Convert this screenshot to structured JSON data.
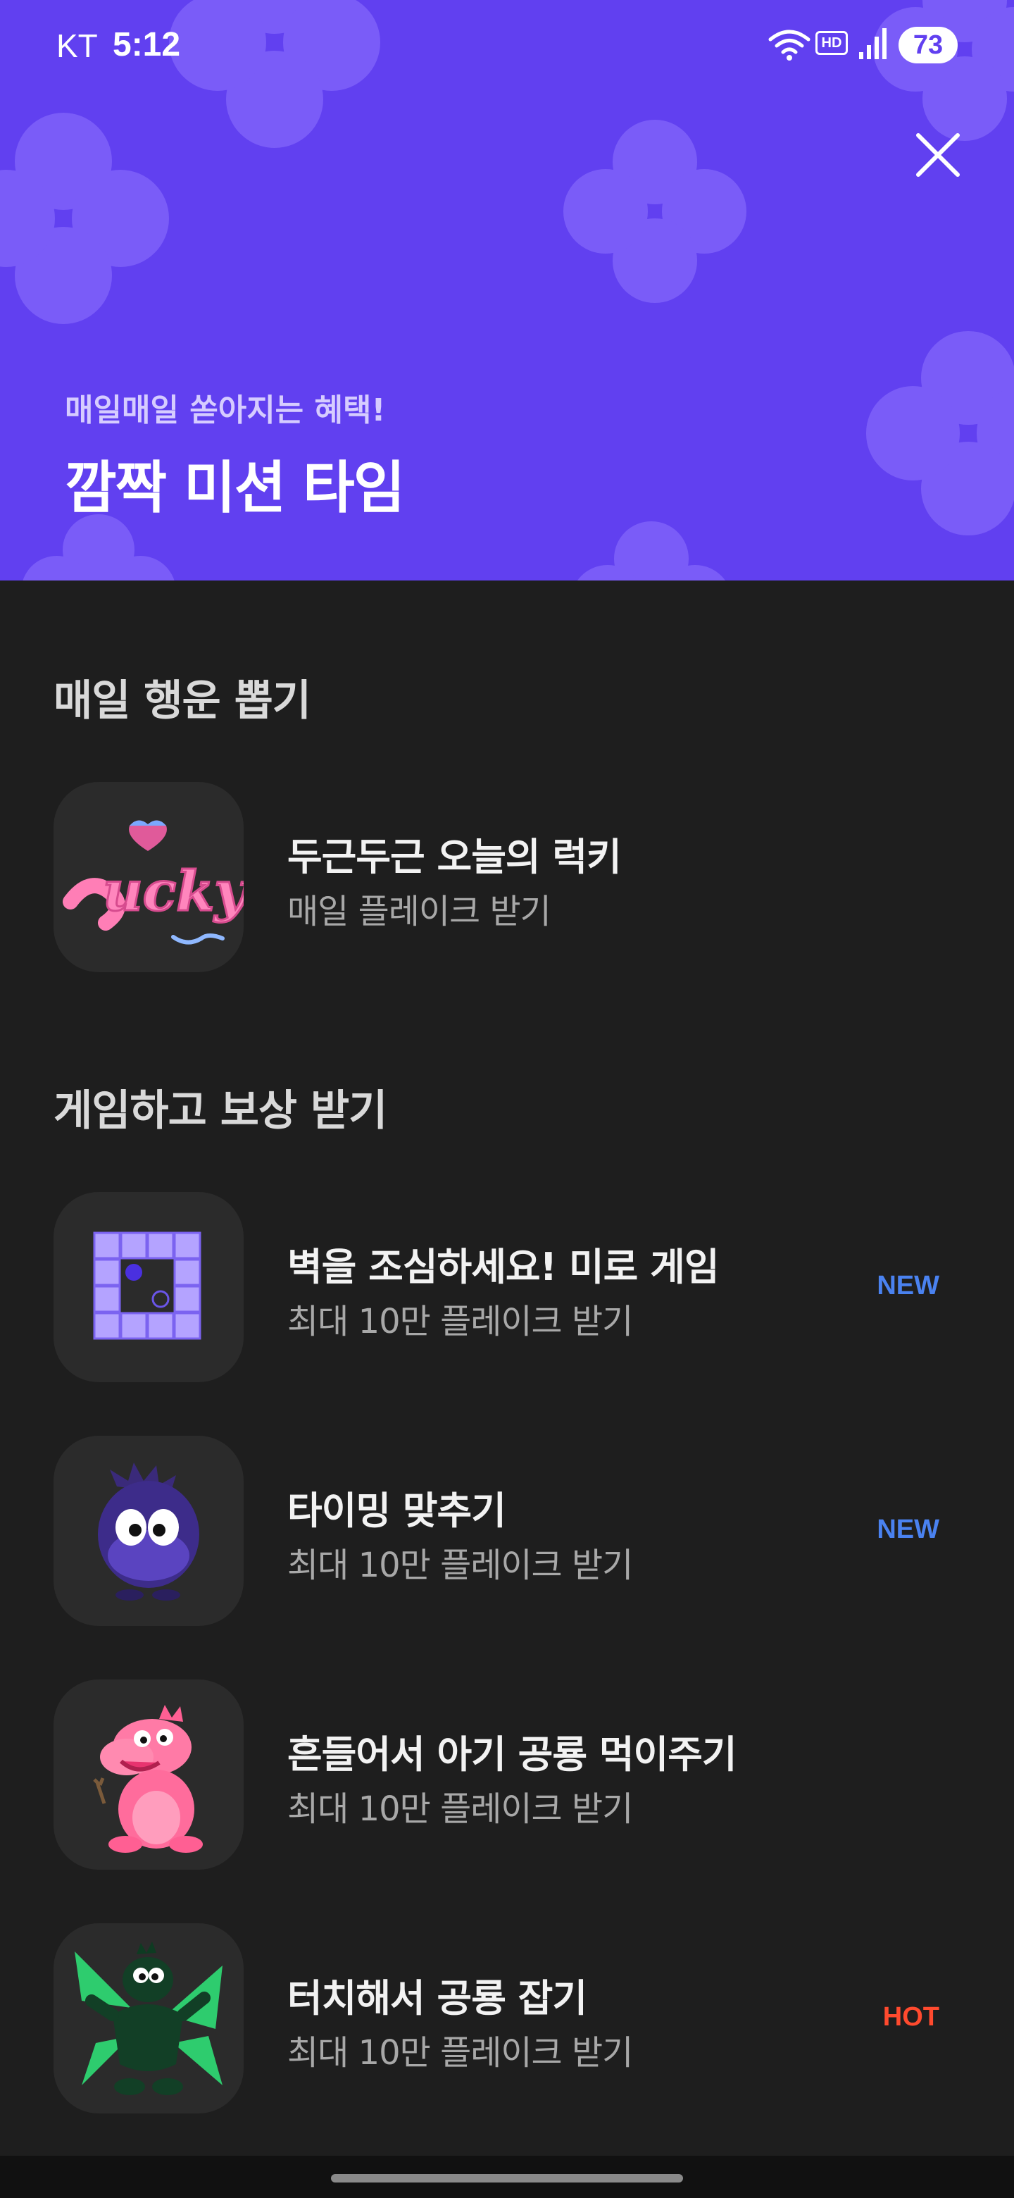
{
  "status_bar": {
    "carrier": "KT",
    "time": "5:12",
    "hd_label": "HD",
    "battery": "73"
  },
  "hero": {
    "subtitle": "매일매일 쏟아지는 혜택!",
    "title": "깜짝 미션 타임",
    "close_icon": "close-icon",
    "background_color": "#6140f0"
  },
  "sections": [
    {
      "title": "매일 행운 뽑기",
      "items": [
        {
          "icon": "lucky-logo-icon",
          "title": "두근두근 오늘의 럭키",
          "subtitle": "매일 플레이크 받기",
          "badge": ""
        }
      ]
    },
    {
      "title": "게임하고 보상 받기",
      "items": [
        {
          "icon": "maze-icon",
          "title": "벽을 조심하세요! 미로 게임",
          "subtitle": "최대 10만 플레이크 받기",
          "badge": "NEW"
        },
        {
          "icon": "purple-monster-icon",
          "title": "타이밍 맞추기",
          "subtitle": "최대 10만 플레이크 받기",
          "badge": "NEW"
        },
        {
          "icon": "pink-dinosaur-icon",
          "title": "흔들어서 아기 공룡 먹이주기",
          "subtitle": "최대 10만 플레이크 받기",
          "badge": ""
        },
        {
          "icon": "green-dinosaur-icon",
          "title": "터치해서 공룡 잡기",
          "subtitle": "최대 10만 플레이크 받기",
          "badge": "HOT"
        }
      ]
    }
  ],
  "colors": {
    "accent_purple": "#6140f0",
    "badge_new": "#4a82f0",
    "badge_hot": "#ff4a2e",
    "background": "#1e1e1e"
  }
}
